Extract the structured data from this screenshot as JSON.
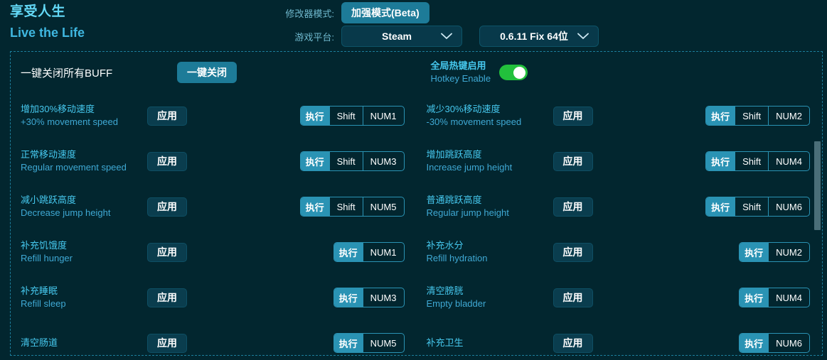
{
  "header": {
    "title_cn": "享受人生",
    "title_en": "Live the Life",
    "mode_label": "修改器模式:",
    "mode_button": "加强模式(Beta)",
    "platform_label": "游戏平台:",
    "platform_value": "Steam",
    "version_value": "0.6.11 Fix 64位",
    "chevron_icon": "chevron-down-icon"
  },
  "topbar": {
    "buff_label": "一键关闭所有BUFF",
    "close_all_button": "一键关闭",
    "hotkey_enable_cn": "全局热键启用",
    "hotkey_enable_en": "Hotkey Enable",
    "hotkey_enable_state": "on"
  },
  "common": {
    "apply_label": "应用",
    "exec_label": "执行",
    "modifier_shift": "Shift"
  },
  "colors": {
    "background": "#02262f",
    "accent_teal": "#2a93b4",
    "button_teal": "#1d7b98",
    "label_cyan": "#46c8ee",
    "label_blue": "#3fa9d4",
    "toggle_green": "#22c03c",
    "dashed_border": "#1c7e9c",
    "scrollbar": "#4a6e78"
  },
  "rows": [
    {
      "left": {
        "cn": "增加30%移动速度",
        "en": "+30% movement speed",
        "apply": "应用",
        "exec": "执行",
        "mod": "Shift",
        "key": "NUM1"
      },
      "right": {
        "cn": "减少30%移动速度",
        "en": "-30% movement speed",
        "apply": "应用",
        "exec": "执行",
        "mod": "Shift",
        "key": "NUM2"
      }
    },
    {
      "left": {
        "cn": "正常移动速度",
        "en": "Regular movement speed",
        "apply": "应用",
        "exec": "执行",
        "mod": "Shift",
        "key": "NUM3"
      },
      "right": {
        "cn": "增加跳跃高度",
        "en": "Increase jump height",
        "apply": "应用",
        "exec": "执行",
        "mod": "Shift",
        "key": "NUM4"
      }
    },
    {
      "left": {
        "cn": "减小跳跃高度",
        "en": "Decrease jump height",
        "apply": "应用",
        "exec": "执行",
        "mod": "Shift",
        "key": "NUM5"
      },
      "right": {
        "cn": "普通跳跃高度",
        "en": "Regular jump height",
        "apply": "应用",
        "exec": "执行",
        "mod": "Shift",
        "key": "NUM6"
      }
    },
    {
      "left": {
        "cn": "补充饥饿度",
        "en": "Refill hunger",
        "apply": "应用",
        "exec": "执行",
        "mod": "",
        "key": "NUM1"
      },
      "right": {
        "cn": "补充水分",
        "en": "Refill hydration",
        "apply": "应用",
        "exec": "执行",
        "mod": "",
        "key": "NUM2"
      }
    },
    {
      "left": {
        "cn": "补充睡眠",
        "en": "Refill sleep",
        "apply": "应用",
        "exec": "执行",
        "mod": "",
        "key": "NUM3"
      },
      "right": {
        "cn": "清空膀胱",
        "en": "Empty bladder",
        "apply": "应用",
        "exec": "执行",
        "mod": "",
        "key": "NUM4"
      }
    },
    {
      "left": {
        "cn": "清空肠道",
        "en": "",
        "apply": "应用",
        "exec": "执行",
        "mod": "",
        "key": "NUM5"
      },
      "right": {
        "cn": "补充卫生",
        "en": "",
        "apply": "应用",
        "exec": "执行",
        "mod": "",
        "key": "NUM6"
      }
    }
  ],
  "scrollbar": {
    "name": "vertical-scrollbar"
  }
}
